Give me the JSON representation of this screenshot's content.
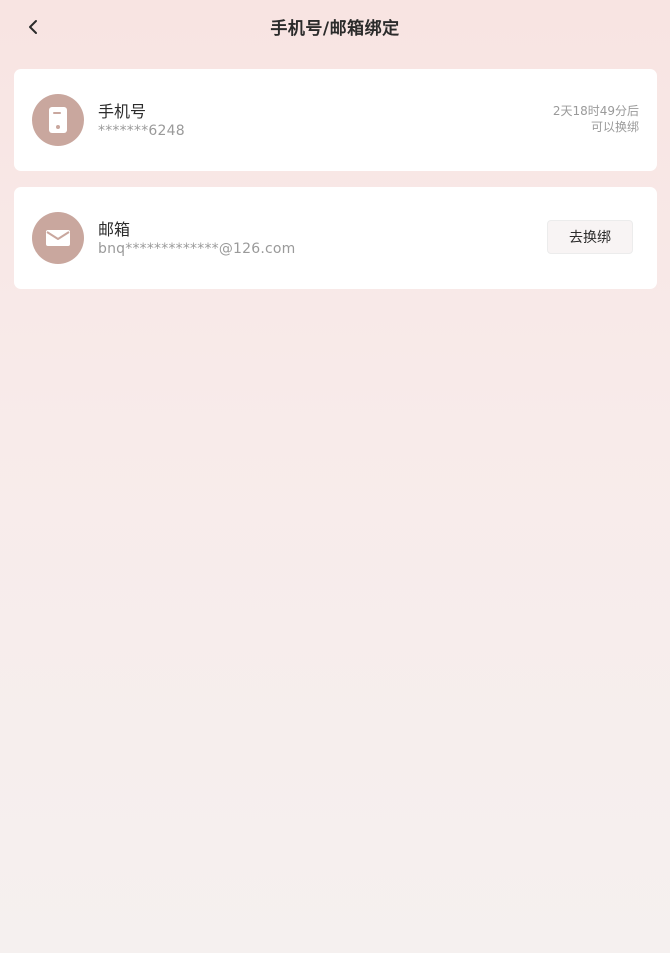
{
  "header": {
    "title": "手机号/邮箱绑定",
    "back_icon": "chevron-left-icon"
  },
  "phone": {
    "label": "手机号",
    "value": "*******6248",
    "note_line1": "2天18时49分后",
    "note_line2": "可以换绑",
    "icon": "phone-icon"
  },
  "email": {
    "label": "邮箱",
    "value": "bnq*************@126.com",
    "button_label": "去换绑",
    "icon": "mail-icon"
  },
  "colors": {
    "avatar_bg": "#c9a79e",
    "background_top": "#f8e4e2",
    "background_bottom": "#f5f0ef"
  }
}
